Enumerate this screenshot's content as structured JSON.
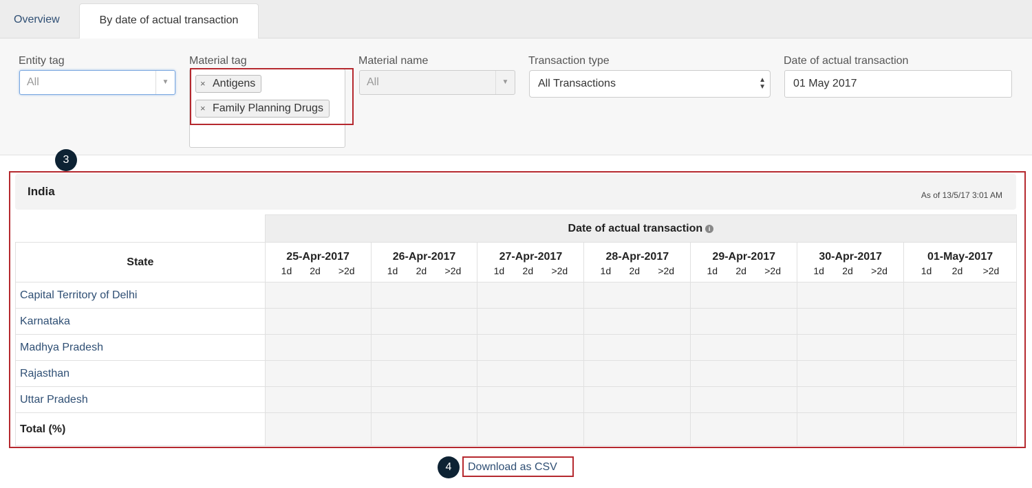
{
  "tabs": [
    {
      "label": "Overview"
    },
    {
      "label": "By date of actual transaction"
    }
  ],
  "filters": {
    "entity_tag": {
      "label": "Entity tag",
      "placeholder": "All"
    },
    "material_tag": {
      "label": "Material tag",
      "chips": [
        "Antigens",
        "Family Planning Drugs"
      ],
      "remove_glyph": "×"
    },
    "material_name": {
      "label": "Material name",
      "placeholder": "All"
    },
    "transaction_type": {
      "label": "Transaction type",
      "value": "All Transactions"
    },
    "date": {
      "label": "Date of actual transaction",
      "value": "01 May 2017"
    }
  },
  "callouts": [
    "3",
    "4"
  ],
  "report": {
    "title": "India",
    "as_of": "As of 13/5/17 3:01 AM",
    "group_header": "Date of actual transaction",
    "state_header": "State",
    "dates": [
      "25-Apr-2017",
      "26-Apr-2017",
      "27-Apr-2017",
      "28-Apr-2017",
      "29-Apr-2017",
      "30-Apr-2017",
      "01-May-2017"
    ],
    "buckets": [
      "1d",
      "2d",
      ">2d"
    ],
    "states": [
      "Capital Territory of Delhi",
      "Karnataka",
      "Madhya Pradesh",
      "Rajasthan",
      "Uttar Pradesh"
    ],
    "total_label": "Total (%)"
  },
  "download_label": "Download as CSV",
  "colors": {
    "highlight": "#b5282e",
    "link": "#2f4f74",
    "callout": "#0d2233"
  }
}
